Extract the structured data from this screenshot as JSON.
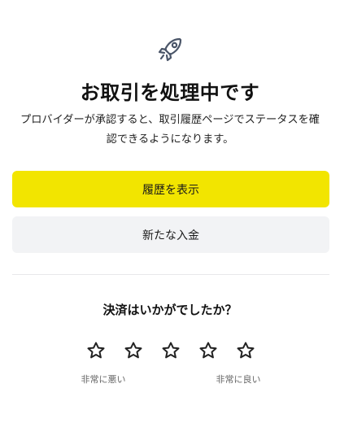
{
  "status": {
    "icon": "rocket-icon",
    "title": "お取引を処理中です",
    "description_line1": "プロバイダーが承認すると、取引履歴ページでステータスを確",
    "description_line2": "認できるようになります。"
  },
  "actions": {
    "primary_label": "履歴を表示",
    "secondary_label": "新たな入金"
  },
  "rating": {
    "question": "決済はいかがでしたか？",
    "star_count": 5,
    "star_icon": "star-outline-icon",
    "low_label": "非常に悪い",
    "high_label": "非常に良い"
  },
  "colors": {
    "primary_button": "#f2e500",
    "secondary_button": "#f2f3f5",
    "icon_stroke": "#4a5568"
  }
}
